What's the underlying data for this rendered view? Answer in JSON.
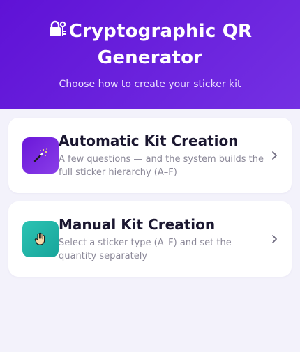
{
  "header": {
    "title_icon": "lock-key-icon",
    "title": "Cryptographic QR Generator",
    "subtitle": "Choose how to create your sticker kit",
    "colors": {
      "gradient_start": "#5f12d6",
      "gradient_end": "#7430e3"
    }
  },
  "options": [
    {
      "icon": "magic-wand-icon",
      "icon_bg": "#6a17d9",
      "title": "Automatic Kit Creation",
      "description": "A few questions — and the system builds the full sticker hierarchy (A–F)",
      "chevron": "chevron-right-icon"
    },
    {
      "icon": "hand-icon",
      "icon_bg": "#2cc3b3",
      "title": "Manual Kit Creation",
      "description": "Select a sticker type (A–F) and set the quantity separately",
      "chevron": "chevron-right-icon"
    }
  ]
}
